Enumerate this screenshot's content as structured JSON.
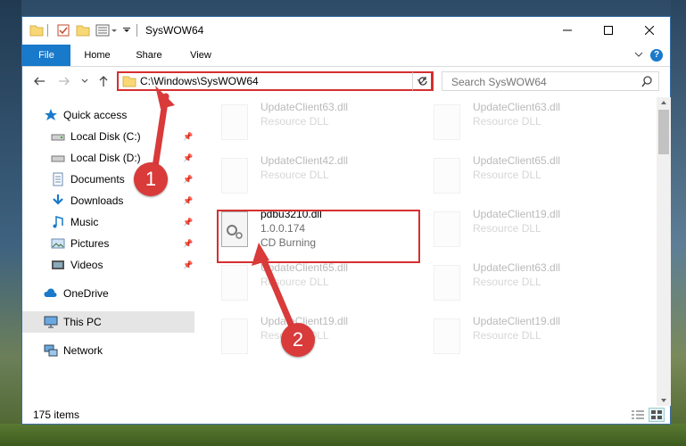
{
  "window": {
    "title": "SysWOW64"
  },
  "ribbon": {
    "tabs": [
      "File",
      "Home",
      "Share",
      "View"
    ]
  },
  "address": {
    "path": "C:\\Windows\\SysWOW64"
  },
  "search": {
    "placeholder": "Search SysWOW64"
  },
  "sidebar": {
    "items": [
      {
        "label": "Quick access",
        "icon": "star-icon"
      },
      {
        "label": "Local Disk (C:)",
        "icon": "drive-icon"
      },
      {
        "label": "Local Disk (D:)",
        "icon": "drive-icon"
      },
      {
        "label": "Documents",
        "icon": "documents-icon"
      },
      {
        "label": "Downloads",
        "icon": "download-icon"
      },
      {
        "label": "Music",
        "icon": "music-icon"
      },
      {
        "label": "Pictures",
        "icon": "pictures-icon"
      },
      {
        "label": "Videos",
        "icon": "videos-icon"
      },
      {
        "label": "OneDrive",
        "icon": "cloud-icon"
      },
      {
        "label": "This PC",
        "icon": "computer-icon"
      },
      {
        "label": "Network",
        "icon": "network-icon"
      }
    ]
  },
  "files": [
    {
      "name": "UpdateClient63.dll",
      "type": "Resource DLL"
    },
    {
      "name": "UpdateClient63.dll",
      "type": "Resource DLL"
    },
    {
      "name": "UpdateClient42.dll",
      "type": "Resource DLL"
    },
    {
      "name": "UpdateClient65.dll",
      "type": "Resource DLL"
    },
    {
      "name": "pdbu3210.dll",
      "version": "1.0.0.174",
      "type": "CD Burning"
    },
    {
      "name": "UpdateClient19.dll",
      "type": "Resource DLL"
    },
    {
      "name": "UpdateClient65.dll",
      "type": "Resource DLL"
    },
    {
      "name": "UpdateClient63.dll",
      "type": "Resource DLL"
    },
    {
      "name": "UpdateClient19.dll",
      "type": "Resource DLL"
    },
    {
      "name": "UpdateClient19.dll",
      "type": "Resource DLL"
    }
  ],
  "status": {
    "count": "175 items"
  },
  "annotations": [
    "1",
    "2"
  ],
  "colors": {
    "accent": "#1979ca",
    "highlight": "#d62f2f"
  }
}
